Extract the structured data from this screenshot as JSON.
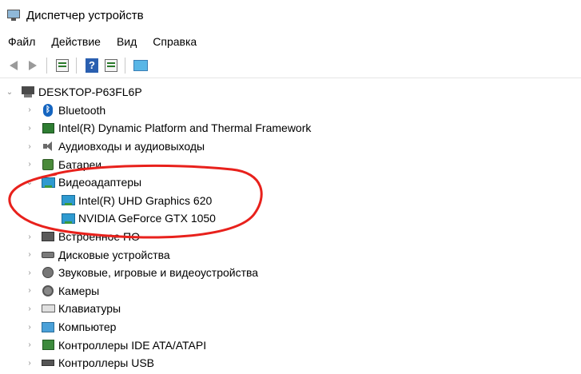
{
  "window": {
    "title": "Диспетчер устройств"
  },
  "menu": [
    "Файл",
    "Действие",
    "Вид",
    "Справка"
  ],
  "colors": {
    "annotation": "#e8211c",
    "selected_bg": "#cce8ff"
  },
  "tree": {
    "root": "DESKTOP-P63FL6P",
    "categories": [
      {
        "label": "Bluetooth",
        "icon": "bluetooth-icon"
      },
      {
        "label": "Intel(R) Dynamic Platform and Thermal Framework",
        "icon": "chip-icon"
      },
      {
        "label": "Аудиовходы и аудиовыходы",
        "icon": "speaker-icon"
      },
      {
        "label": "Батареи",
        "icon": "battery-icon"
      },
      {
        "label": "Видеоадаптеры",
        "icon": "display-adapter-icon",
        "expanded": true,
        "children": [
          {
            "label": "Intel(R) UHD Graphics 620",
            "icon": "display-adapter-icon"
          },
          {
            "label": "NVIDIA GeForce GTX 1050",
            "icon": "display-adapter-icon"
          }
        ]
      },
      {
        "label": "Встроенное ПО",
        "icon": "firmware-icon"
      },
      {
        "label": "Дисковые устройства",
        "icon": "disk-icon"
      },
      {
        "label": "Звуковые, игровые и видеоустройства",
        "icon": "sound-icon"
      },
      {
        "label": "Камеры",
        "icon": "camera-icon"
      },
      {
        "label": "Клавиатуры",
        "icon": "keyboard-icon"
      },
      {
        "label": "Компьютер",
        "icon": "computer-icon"
      },
      {
        "label": "Контроллеры IDE ATA/ATAPI",
        "icon": "ide-controller-icon"
      },
      {
        "label": "Контроллеры USB",
        "icon": "usb-icon"
      }
    ]
  }
}
